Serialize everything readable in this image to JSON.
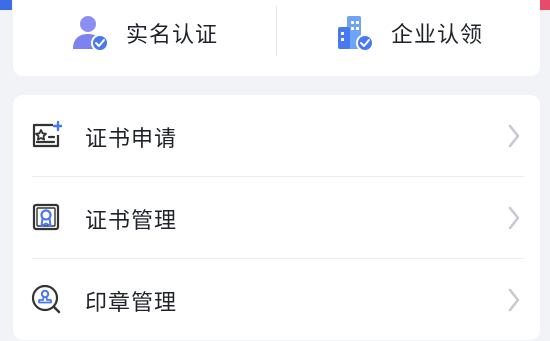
{
  "theme": {
    "accent": "#4a78f0",
    "accent_light": "#6fa3f7",
    "avatar_purple": "#7b83f0",
    "corner_left": "#3d6ce8",
    "corner_right": "#e84a6a",
    "text": "#1f2329",
    "icon_stroke": "#333333",
    "chevron": "#c8cad0"
  },
  "top_actions": [
    {
      "label": "实名认证",
      "icon": "user-verified-icon"
    },
    {
      "label": "企业认领",
      "icon": "enterprise-building-icon"
    }
  ],
  "menu": {
    "items": [
      {
        "label": "证书申请",
        "icon": "certificate-apply-icon"
      },
      {
        "label": "证书管理",
        "icon": "certificate-manage-icon"
      },
      {
        "label": "印章管理",
        "icon": "seal-manage-icon"
      }
    ]
  }
}
